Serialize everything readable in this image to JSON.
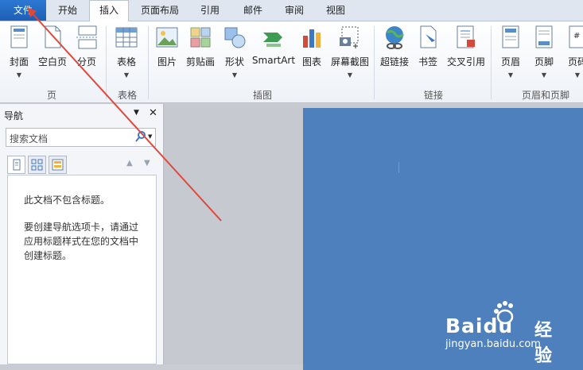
{
  "tabs": [
    "文件",
    "开始",
    "插入",
    "页面布局",
    "引用",
    "邮件",
    "审阅",
    "视图"
  ],
  "ribbon": {
    "buttons": [
      "封面",
      "空白页",
      "分页",
      "表格",
      "图片",
      "剪贴画",
      "形状",
      "SmartArt",
      "图表",
      "屏幕截图",
      "超链接",
      "书签",
      "交叉引用",
      "页眉",
      "页脚",
      "页码"
    ],
    "groups": [
      "页",
      "表格",
      "插图",
      "链接",
      "页眉和页脚"
    ]
  },
  "nav": {
    "title": "导航",
    "search_placeholder": "搜索文档",
    "msg1": "此文档不包含标题。",
    "msg2_l1": "要创建导航选项卡，请通过",
    "msg2_l2": "应用标题样式在您的文档中",
    "msg2_l3": "创建标题。"
  },
  "watermark": {
    "brand": "Baidu",
    "cn": "经验",
    "url": "jingyan.baidu.com"
  },
  "colors": {
    "file_tab": "#1f5fb5",
    "doc_page": "#4d80bd",
    "arrow": "#e2473c"
  }
}
